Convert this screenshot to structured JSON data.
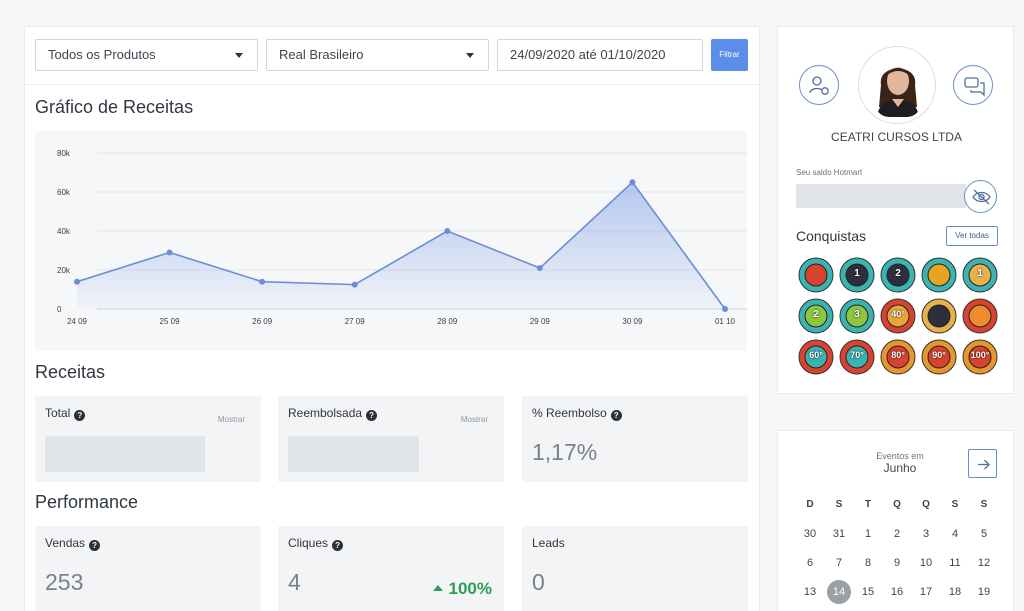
{
  "filters": {
    "product": "Todos os Produtos",
    "currency": "Real Brasileiro",
    "date_range": "24/09/2020 até 01/10/2020",
    "filter_button": "Filtrar"
  },
  "chart_section": {
    "title": "Gráfico de Receitas"
  },
  "chart_data": {
    "type": "area",
    "title": "",
    "x": [
      "24 09",
      "25 09",
      "26 09",
      "27 09",
      "28 09",
      "29 09",
      "30 09",
      "01 10"
    ],
    "series": [
      {
        "values": [
          14000,
          29000,
          14000,
          12500,
          40000,
          21000,
          65000,
          0
        ]
      }
    ],
    "yticks": [
      "0",
      "20k",
      "40k",
      "60k",
      "80k"
    ],
    "ylim": [
      0,
      80000
    ],
    "grid": true,
    "line_color": "#6a8fd6"
  },
  "receitas": {
    "title": "Receitas",
    "cards": [
      {
        "label": "Total",
        "show": "Mostrar"
      },
      {
        "label": "Reembolsada",
        "show": "Mostrar"
      },
      {
        "label": "% Reembolso",
        "value": "1,17%"
      }
    ]
  },
  "performance": {
    "title": "Performance",
    "cards": [
      {
        "label": "Vendas",
        "value": "253"
      },
      {
        "label": "Cliques",
        "value": "4",
        "trend": "100%"
      },
      {
        "label": "Leads",
        "value": "0"
      }
    ]
  },
  "profile": {
    "company": "CEATRI CURSOS LTDA",
    "balance_label": "Seu saldo Hotmart",
    "achievements_title": "Conquistas",
    "see_all": "Ver todas",
    "badges": [
      "",
      "1",
      "2",
      "",
      "1",
      "2",
      "3",
      "40°",
      "",
      "",
      "60°",
      "70°",
      "80°",
      "90°",
      "100°"
    ]
  },
  "calendar": {
    "events_label": "Eventos em",
    "month": "Junho",
    "weekdays": [
      "D",
      "S",
      "T",
      "Q",
      "Q",
      "S",
      "S"
    ],
    "weeks": [
      [
        "30",
        "31",
        "1",
        "2",
        "3",
        "4",
        "5"
      ],
      [
        "6",
        "7",
        "8",
        "9",
        "10",
        "11",
        "12"
      ],
      [
        "13",
        "14",
        "15",
        "16",
        "17",
        "18",
        "19"
      ]
    ],
    "today": "14"
  },
  "colors": {
    "accent": "#5b8ee8",
    "positive": "#2b9e56"
  }
}
